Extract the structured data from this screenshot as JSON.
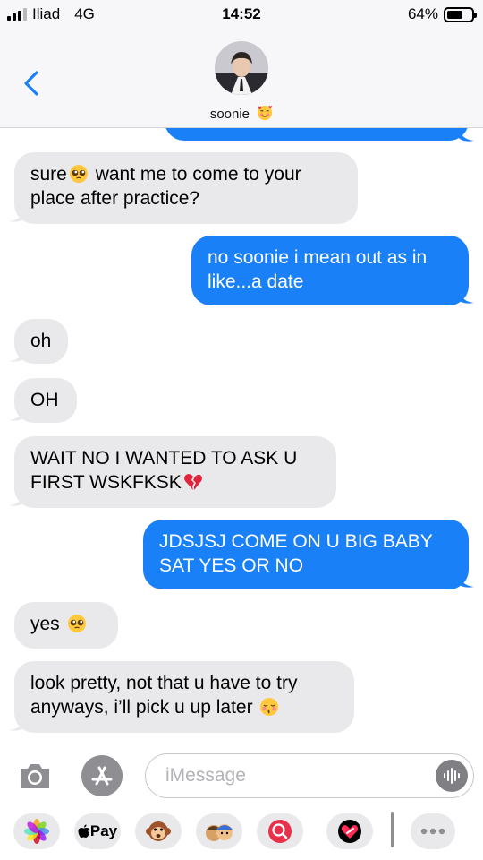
{
  "status": {
    "carrier": "Iliad",
    "network": "4G",
    "time": "14:52",
    "battery_percent_label": "64%",
    "battery_level": 0.64
  },
  "header": {
    "contact_name": "soonie",
    "contact_emoji": "smiling-face-with-hearts-emoji"
  },
  "messages": [
    {
      "from": "contact",
      "text_before": "sure",
      "emoji": "pleading-face-emoji",
      "text_after": " want me to come to your place after practice?"
    },
    {
      "from": "me",
      "text": "no soonie i mean out as in like...a date"
    },
    {
      "from": "contact",
      "text": "oh"
    },
    {
      "from": "contact",
      "text": "OH"
    },
    {
      "from": "contact",
      "text": "WAIT NO I WANTED TO ASK U FIRST WSKFKSK",
      "emoji": "broken-heart-emoji"
    },
    {
      "from": "me",
      "text": "JDSJSJ COME ON U BIG BABY SAT YES OR NO"
    },
    {
      "from": "contact",
      "text": "yes",
      "emoji": "pleading-face-emoji"
    },
    {
      "from": "contact",
      "text": "look pretty, not that u have to try anyways, i’ll pick u up later",
      "emoji": "kissing-face-with-closed-eyes-emoji"
    }
  ],
  "input": {
    "placeholder": "iMessage"
  },
  "drawer": {
    "apple_pay_label": "Pay",
    "apps": [
      "photos-icon",
      "apple-pay-icon",
      "monkey-emoji-icon",
      "memoji-icon",
      "web-search-icon",
      "digital-touch-icon",
      "more-icon"
    ]
  },
  "colors": {
    "outgoing": "#1a80f8",
    "incoming": "#e9e9eb",
    "header_bg": "#f7f7f9"
  }
}
